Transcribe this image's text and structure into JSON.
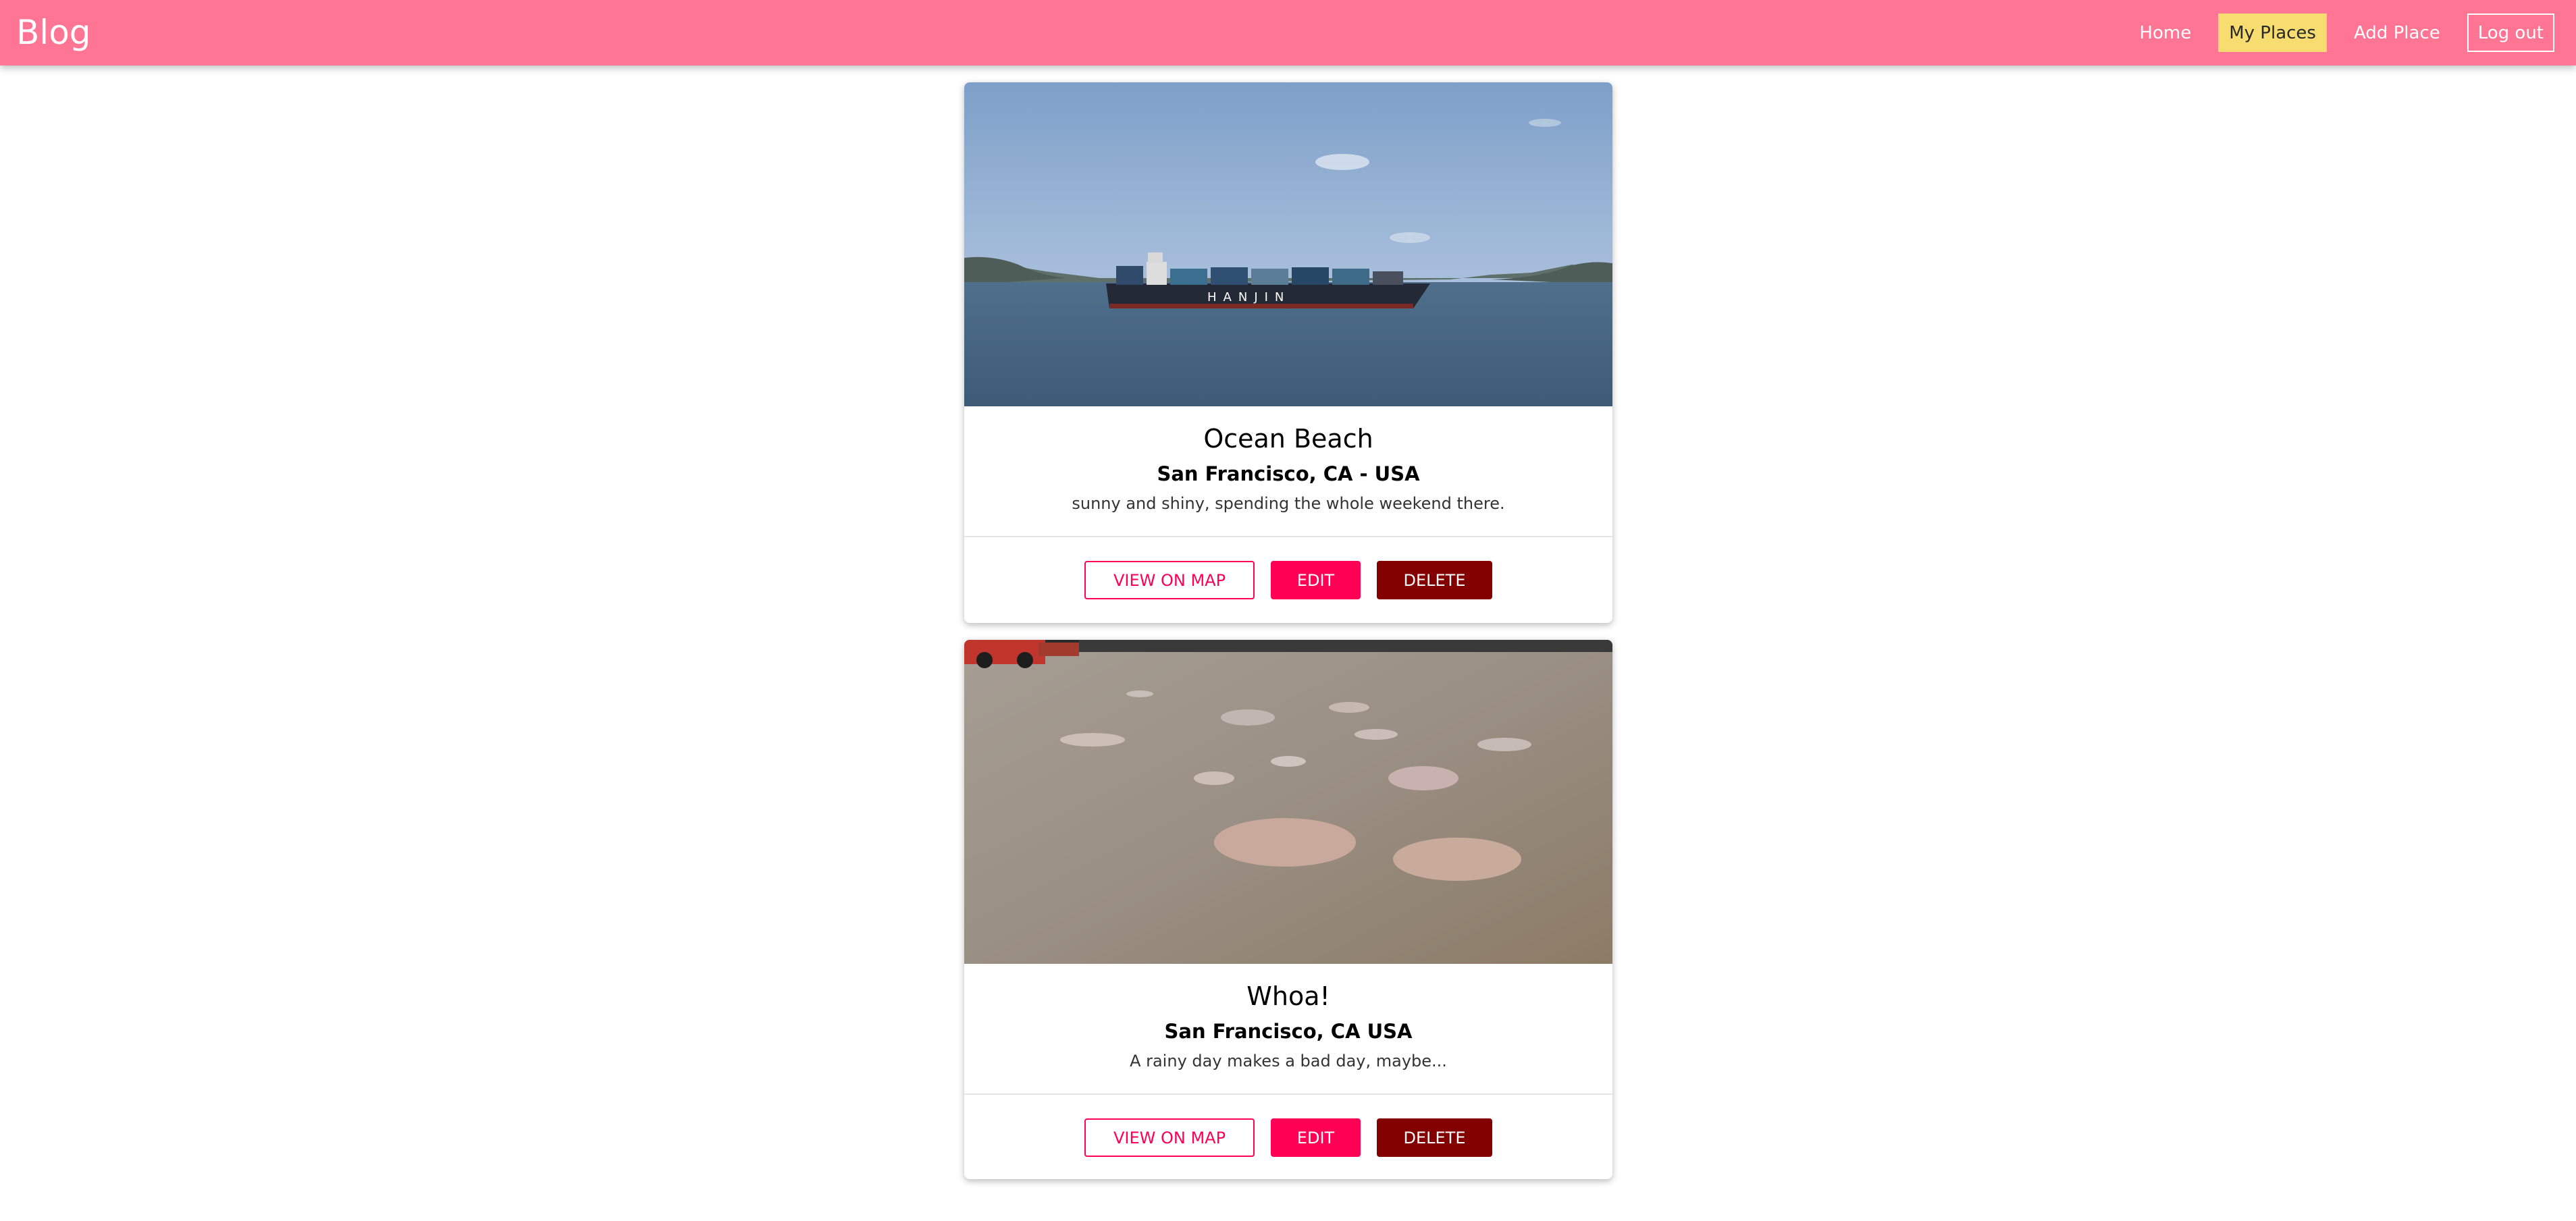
{
  "header": {
    "brand": "Blog",
    "nav": {
      "home": "Home",
      "my_places": "My Places",
      "add_place": "Add Place",
      "logout": "Log out"
    },
    "colors": {
      "bar": "#ff7593",
      "active_item": "#f7dc6f"
    }
  },
  "places": [
    {
      "title": "Ocean Beach",
      "address": "San Francisco, CA - USA",
      "description": "sunny and shiny, spending the whole weekend there.",
      "image_subject": "container ship on bay",
      "ship_name": "HANJIN",
      "actions": {
        "view_on_map": "VIEW ON MAP",
        "edit": "EDIT",
        "delete": "DELETE"
      }
    },
    {
      "title": "Whoa!",
      "address": "San Francisco, CA USA",
      "description": "A rainy day makes a bad day, maybe...",
      "image_subject": "parking lot with puddles",
      "actions": {
        "view_on_map": "VIEW ON MAP",
        "edit": "EDIT",
        "delete": "DELETE"
      }
    }
  ],
  "colors": {
    "primary": "#ff0055",
    "danger": "#830000"
  }
}
